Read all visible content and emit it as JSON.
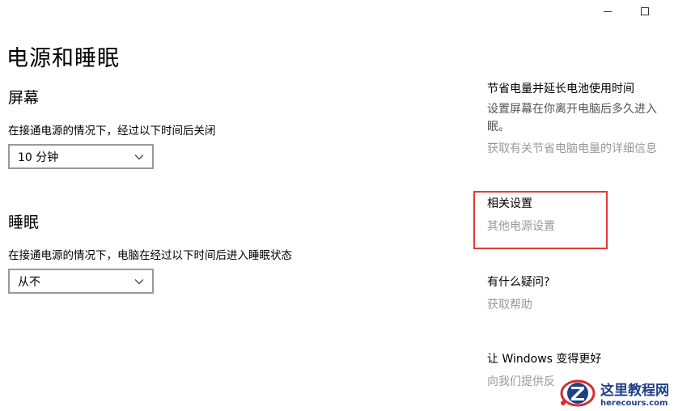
{
  "window": {
    "minimize_icon": "minimize-icon",
    "maximize_icon": "maximize-icon"
  },
  "page": {
    "title": "电源和睡眠"
  },
  "screen": {
    "title": "屏幕",
    "description": "在接通电源的情况下，经过以下时间后关闭",
    "selected": "10 分钟"
  },
  "sleep": {
    "title": "睡眠",
    "description": "在接通电源的情况下，电脑在经过以下时间后进入睡眠状态",
    "selected": "从不"
  },
  "sidebar": {
    "tip": {
      "heading": "节省电量并延长电池使用时间",
      "line1": "设置屏幕在你离开电脑后多久进入",
      "line2": "眠。",
      "link": "获取有关节省电脑电量的详细信息"
    },
    "related": {
      "heading": "相关设置",
      "link": "其他电源设置"
    },
    "help": {
      "heading": "有什么疑问?",
      "link": "获取帮助"
    },
    "feedback": {
      "heading": "让 Windows 变得更好",
      "link": "向我们提供反"
    }
  },
  "watermark": {
    "cn": "这里教程网",
    "en": "herecours.com"
  },
  "colors": {
    "highlight": "#e53935",
    "link_gray": "#999999",
    "watermark_blue": "#1f3f86"
  }
}
